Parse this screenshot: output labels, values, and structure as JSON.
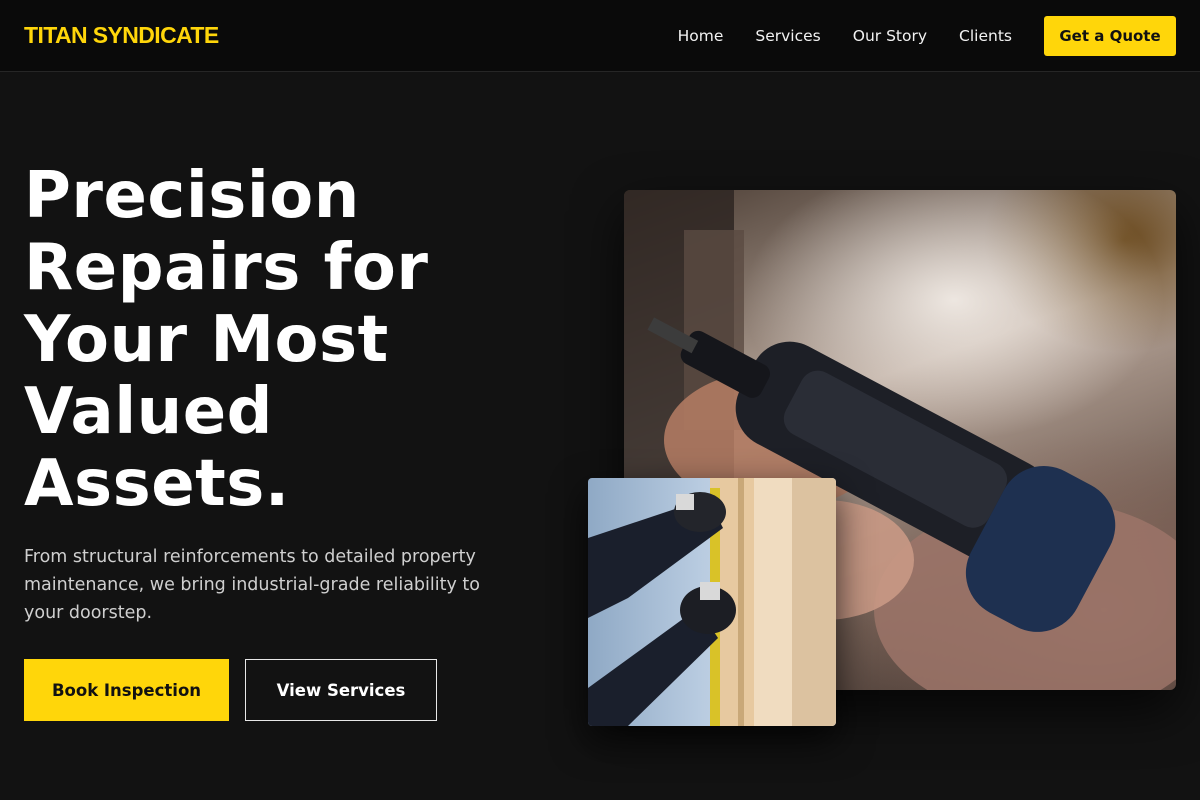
{
  "header": {
    "brand": "TITAN SYNDICATE",
    "nav": [
      {
        "label": "Home"
      },
      {
        "label": "Services"
      },
      {
        "label": "Our Story"
      },
      {
        "label": "Clients"
      }
    ],
    "cta_label": "Get a Quote"
  },
  "hero": {
    "title_lines": [
      "Precision",
      "Repairs for",
      "Your Most",
      "Valued",
      "Assets."
    ],
    "subtitle": "From structural reinforcements to detailed property maintenance, we bring industrial-grade reliability to your doorstep.",
    "primary_button": "Book Inspection",
    "secondary_button": "View Services"
  },
  "colors": {
    "accent": "#ffd60a",
    "background": "#121212",
    "header_background": "#0a0a0a"
  }
}
